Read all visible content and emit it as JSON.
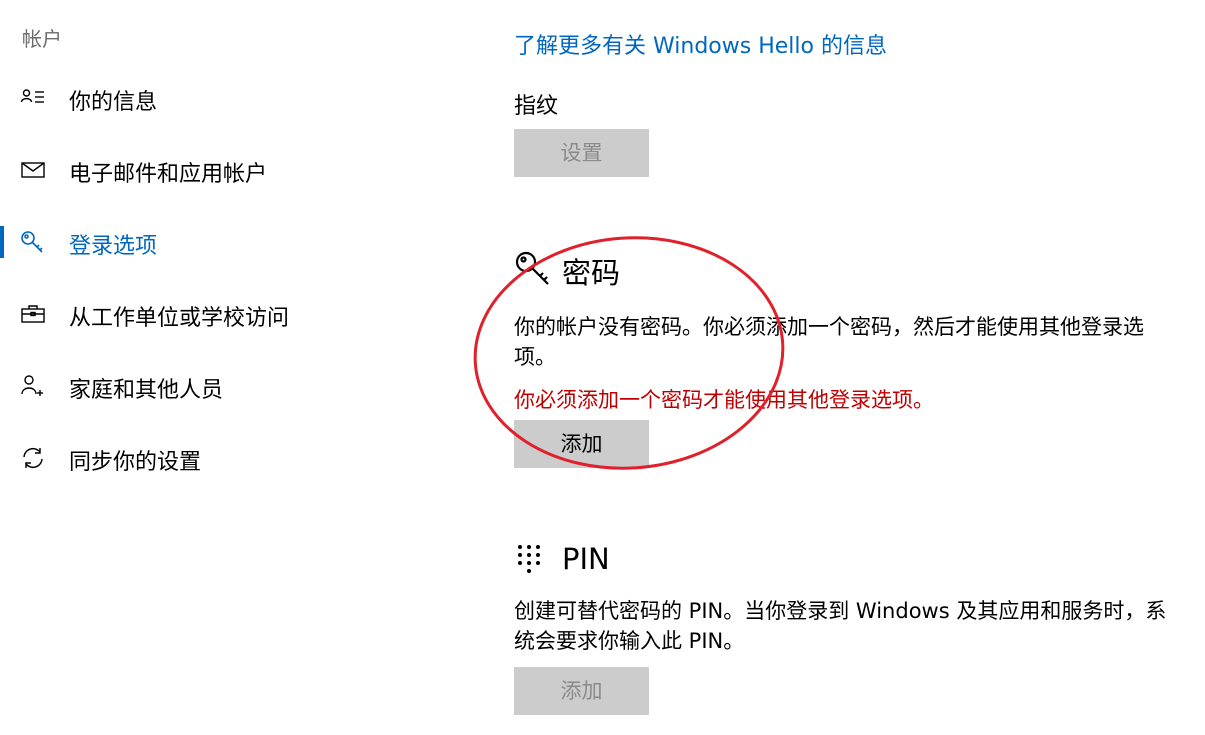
{
  "sidebar": {
    "header": "帐户",
    "items": [
      {
        "label": "你的信息",
        "icon": "person-list-icon",
        "active": false
      },
      {
        "label": "电子邮件和应用帐户",
        "icon": "mail-icon",
        "active": false
      },
      {
        "label": "登录选项",
        "icon": "key-icon",
        "active": true
      },
      {
        "label": "从工作单位或学校访问",
        "icon": "briefcase-icon",
        "active": false
      },
      {
        "label": "家庭和其他人员",
        "icon": "person-add-icon",
        "active": false
      },
      {
        "label": "同步你的设置",
        "icon": "sync-icon",
        "active": false
      }
    ]
  },
  "main": {
    "hello_link": "了解更多有关 Windows Hello 的信息",
    "fingerprint": {
      "heading": "指纹",
      "button": "设置"
    },
    "password": {
      "title": "密码",
      "description": "你的帐户没有密码。你必须添加一个密码，然后才能使用其他登录选项。",
      "warning": "你必须添加一个密码才能使用其他登录选项。",
      "button": "添加"
    },
    "pin": {
      "title": "PIN",
      "description": "创建可替代密码的 PIN。当你登录到 Windows 及其应用和服务时，系统会要求你输入此 PIN。",
      "button": "添加"
    }
  },
  "colors": {
    "accent": "#0067c0",
    "warning": "#c00000",
    "annotation": "#e0202a",
    "button_bg": "#cccccc"
  }
}
